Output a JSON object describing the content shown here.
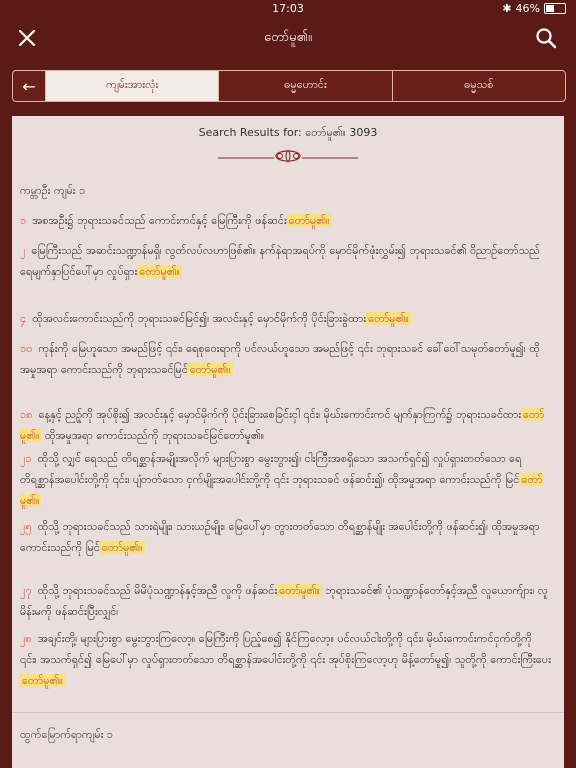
{
  "status": {
    "time": "17:03",
    "battery": "46%",
    "battery_level": 0.46
  },
  "nav": {
    "title": "တော်မူ၏။"
  },
  "tabs": [
    "ကျမ်းအားလုံး",
    "ဓမ္မဟောင်း",
    "ဓမ္မသစ်"
  ],
  "results": {
    "header": "Search Results for: တော်မူ၏။ 3093"
  },
  "chapter": {
    "title": "ကမ္ဘာဦး ကျမ်း ၁",
    "footer": "ထွက်မြောက်ရာကျမ်း ၁"
  },
  "verses": [
    {
      "num": "၁",
      "text": "အစအဦး၌ ဘုရားသခင်သည် ကောင်းကင်နှင့် မြေကြီးကို ဖန်ဆင်း",
      "hl": "တော်မူ၏။",
      "after": ""
    },
    {
      "num": "၂",
      "text": "မြေကြီးသည် အဆင်းသဏ္ဍာန်မရှိ၊ လွတ်လပ်လဟာဖြစ်၏။ နက်နဲရာအရပ်ကို မှောင်မိုက်ဖုံးလွှမ်း၍ ဘုရားသခင်၏ ဝိညာဉ်တော်သည် ရေမျက်နှာပြင်ပေါ်မှာ လှုပ်ရှား",
      "hl": "တော်မူ၏။",
      "after": ""
    },
    {
      "num": "၄",
      "text": "ထိုအလင်းကောင်းသည်ကို ဘုရားသခင်မြင်၍၊ အလင်းနှင့် မှောင်မိုက်ကို ပိုင်းခြားခွဲထား",
      "hl": "တော်မူ၏။",
      "after": ""
    },
    {
      "num": "၁၀",
      "text": "ကုန်းကို မြေဟူသော အမည်ဖြင့် ၎င်း၊ ရေစုဝေးရာကို ပင်လယ်ဟူသော အမည်ဖြင့် ၎င်း ဘုရားသခင် ခေါ်ဝေါ်သမုတ်တော်မူ၍၊ ထိုအမှုအရာ ကောင်းသည်ကို ဘုရားသခင်မြင်",
      "hl": "တော်မူ၏။",
      "after": ""
    },
    {
      "num": "၁၈",
      "text": "နေ့နှင့် ညဥ့်ကို အုပ်စိုး၍ အလင်းနှင့် မှောင်မိုက်ကို ပိုင်းခြားစေခြင်းငှါ ၎င်း၊ မိုဃ်းကောင်းကင် မျက်နှာကြက်၌ ဘုရားသခင်ထား",
      "hl": "တော်မူ၏။",
      "after": " ထိုအမှုအရာ ကောင်းသည်ကို ဘုရားသခင်မြင်တော်မူ၏။"
    },
    {
      "num": "၂၁",
      "text": "ထိုသို့ လျှင် ရေသည် တိရစ္ဆာန်အမျိုးအလိုက် များပြားစွာ မွေးဘွား၍၊ ငါးကြီးအစရှိသော အသက်ရှင်၍ လှုပ်ရှားတတ်သော ရေတိရစ္ဆာန်အပေါင်းတို့ကို ၎င်း၊ ပျံတတ်သော ငှက်မျိုးအပေါင်းတို့ကို ၎င်း ဘုရားသခင် ဖန်ဆင်း၍၊ ထိုအမှုအရာ ကောင်းသည်ကို မြင်",
      "hl": "တော်မူ၏။",
      "after": ""
    },
    {
      "num": "၂၅",
      "text": "ထိုသို့ ဘုရားသခင်သည် သားရဲမျိုး၊ သားယဉ်မျိုး၊ မြေပေါ်မှာ တွားတတ်သော တိရစ္ဆာန်မျိုး အပေါင်းတို့ကို ဖန်ဆင်း၍၊ ထိုအမှုအရာ ကောင်းသည်ကို မြင်",
      "hl": "တော်မူ၏။",
      "after": ""
    },
    {
      "num": "၂၇",
      "text": "ထိုသို့ ဘုရားသခင်သည် မိမိပုံသဏ္ဍာန်နှင့်အညီ လူကို ဖန်ဆင်း",
      "hl": "တော်မူ၏။",
      "after": " ဘုရားသခင်၏ ပုံသဏ္ဍာန်တော်နှင့်အညီ လူယောက်ျား၊ လူမိန်းမကို ဖန်ဆင်းပြီးလျှင်၊"
    },
    {
      "num": "၂၈",
      "text": "အချင်းတို့၊ များပြားစွာ မွေးဘွားကြလော့။ မြေကြီးကို ပြည့်စေ၍ နိုင်ကြလော့။ ပင်လယ်ငါးတို့ကို ၎င်း၊ မိုဃ်းကောင်းကင်ငှက်တို့ကို ၎င်း၊ အသက်ရှင်၍ မြေပေါ်မှာ လှုပ်ရှားတတ်သော တိရစ္ဆာန်အပေါင်းတို့ကို ၎င်း အုပ်စိုးကြလော့ဟု မိန့်တော်မူ၍၊ သူတို့ကို ကောင်းကြီးပေး",
      "hl": "တော်မူ၏။",
      "after": ""
    }
  ]
}
